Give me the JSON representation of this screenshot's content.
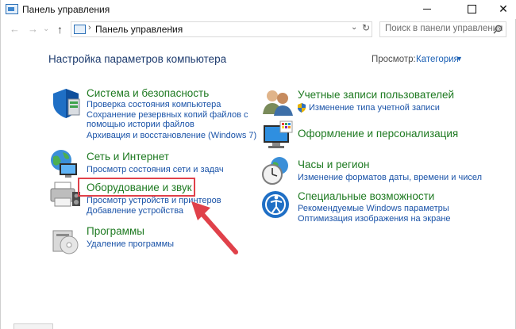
{
  "window": {
    "title": "Панель управления"
  },
  "nav": {
    "address": "Панель управления",
    "search_placeholder": "Поиск в панели управления"
  },
  "header": {
    "title": "Настройка параметров компьютера",
    "view_label": "Просмотр:",
    "view_value": "Категория"
  },
  "categories": [
    {
      "title": "Система и безопасность",
      "links": [
        "Проверка состояния компьютера",
        "Сохранение резервных копий файлов с",
        "помощью истории файлов",
        "Архивация и восстановление (Windows 7)"
      ],
      "icon": "shield-icon"
    },
    {
      "title": "Сеть и Интернет",
      "links": [
        "Просмотр состояния сети и задач"
      ],
      "icon": "network-globe-icon"
    },
    {
      "title": "Оборудование и звук",
      "links": [
        "Просмотр устройств и принтеров",
        "Добавление устройства"
      ],
      "icon": "printer-icon"
    },
    {
      "title": "Программы",
      "links": [
        "Удаление программы"
      ],
      "icon": "programs-icon"
    },
    {
      "title": "Учетные записи пользователей",
      "links": [
        "Изменение типа учетной записи"
      ],
      "icon": "users-icon"
    },
    {
      "title": "Оформление и персонализация",
      "links": [],
      "icon": "monitor-palette-icon"
    },
    {
      "title": "Часы и регион",
      "links": [
        "Изменение форматов даты, времени и чисел"
      ],
      "icon": "clock-globe-icon"
    },
    {
      "title": "Специальные возможности",
      "links": [
        "Рекомендуемые Windows параметры",
        "Оптимизация изображения на экране"
      ],
      "icon": "accessibility-icon"
    }
  ],
  "colors": {
    "accent_link": "#1a53a8",
    "category_title": "#1e7a21",
    "highlight": "#e0414a"
  }
}
